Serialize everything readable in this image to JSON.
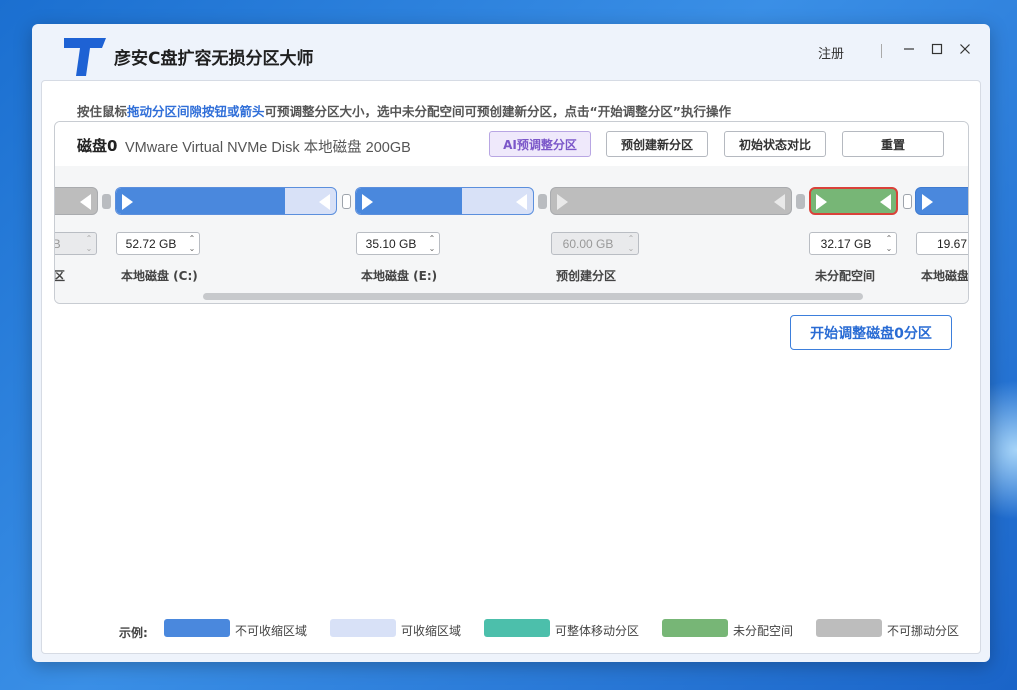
{
  "app": {
    "title": "彦安C盘扩容无损分区大师",
    "register_label": "注册",
    "window_controls": [
      "minimize-icon",
      "maximize-icon",
      "close-icon"
    ]
  },
  "hint": {
    "prefix": "按住鼠标",
    "highlight": "拖动分区间隙按钮或箭头",
    "suffix": "可预调整分区大小，选中未分配空间可预创建新分区，点击“开始调整分区”执行操作"
  },
  "disk": {
    "name": "磁盘0",
    "description": "VMware Virtual NVMe Disk 本地磁盘 200GB",
    "buttons": {
      "ai_adjust": "AI预调整分区",
      "precreate": "预创建新分区",
      "compare": "初始状态对比",
      "reset": "重置"
    }
  },
  "partitions": [
    {
      "label": "区",
      "size": ") MB",
      "type": "unmovable",
      "used_fraction": 1.0
    },
    {
      "label": "本地磁盘 (C:)",
      "size": "52.72 GB",
      "type": "resizable",
      "used_fraction": 0.77
    },
    {
      "label": "本地磁盘 (E:)",
      "size": "35.10 GB",
      "type": "resizable",
      "used_fraction": 0.6
    },
    {
      "label": "预创建分区",
      "size": "60.00 GB",
      "type": "unmovable",
      "used_fraction": 1.0
    },
    {
      "label": "未分配空间",
      "size": "32.17 GB",
      "type": "unallocated",
      "used_fraction": 1.0,
      "selected": true
    },
    {
      "label": "本地磁盘",
      "size": "19.67",
      "type": "resizable",
      "used_fraction": 1.0
    }
  ],
  "start_button": "开始调整磁盘0分区",
  "legend": {
    "title": "示例:",
    "items": [
      {
        "label": "不可收缩区域",
        "color": "#4a88dd"
      },
      {
        "label": "可收缩区域",
        "color": "#d8e1f7"
      },
      {
        "label": "可整体移动分区",
        "color": "#4cbfab"
      },
      {
        "label": "未分配空间",
        "color": "#77b676"
      },
      {
        "label": "不可挪动分区",
        "color": "#bdbdbd"
      }
    ]
  },
  "colors": {
    "accent": "#2f6ed8",
    "fixed": "#4a88dd",
    "shrinkable": "#d8e1f7",
    "unallocated": "#77b676",
    "unmovable": "#bdbdbd",
    "selected_border": "#d9423a"
  }
}
